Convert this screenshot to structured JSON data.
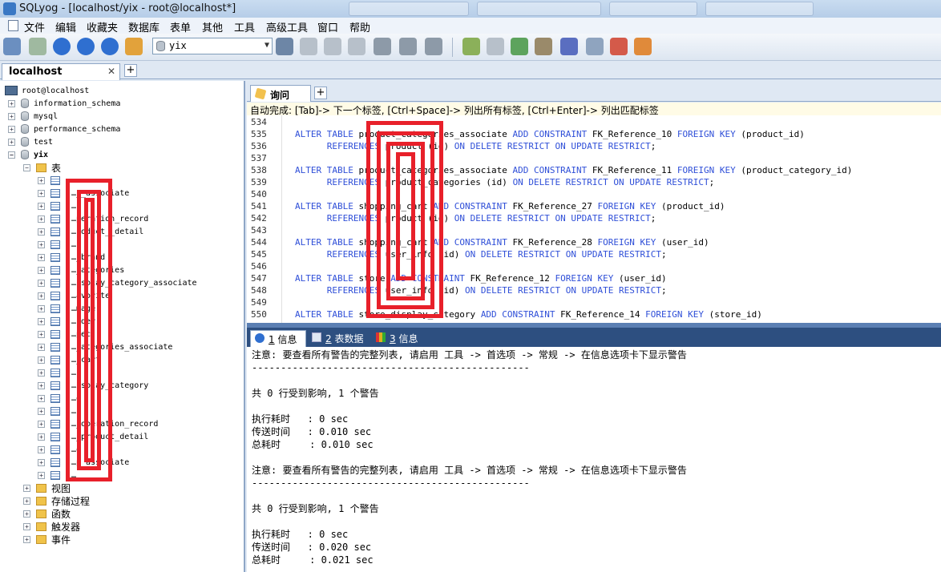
{
  "window": {
    "title": "SQLyog - [localhost/yix - root@localhost*]"
  },
  "menu": [
    "文件",
    "编辑",
    "收藏夹",
    "数据库",
    "表单",
    "其他",
    "工具",
    "高级工具",
    "窗口",
    "帮助"
  ],
  "toolbar": {
    "database_selected": "yix",
    "buttons": [
      "new-connection-icon",
      "refresh-icon",
      "execute-query-icon",
      "execute-all-icon",
      "stop-icon",
      "export-icon",
      "user-manager-icon",
      "create-database-icon",
      "create-table-icon",
      "backup-icon",
      "restore-icon",
      "grid-icon",
      "table-data-icon",
      "result-icon",
      "import-icon",
      "copy-database-icon",
      "schema-sync-icon",
      "data-sync-icon",
      "query-builder-icon",
      "schema-designer-icon",
      "job-agent-icon",
      "notify-icon"
    ]
  },
  "connection_tab": {
    "label": "localhost"
  },
  "object_browser": {
    "root": "root@localhost",
    "databases": [
      "information_schema",
      "mysql",
      "performance_schema",
      "test",
      "yix"
    ],
    "tables_folder": "表",
    "tables": [
      "",
      "…__associate",
      "…",
      "…peration_record",
      "…roduct__detail",
      "…",
      "…_brand",
      "…_ategories",
      "…isplay_category_associate",
      "…avorite",
      "…mage",
      "…rder",
      "…pec",
      "…_ategories_associate",
      "…_cart",
      "…",
      "…isplay_category",
      "…o",
      "…",
      "…_operation_record",
      "…_product_detail",
      "…o",
      "…p_associate",
      "…"
    ],
    "folders": [
      "视图",
      "存储过程",
      "函数",
      "触发器",
      "事件"
    ]
  },
  "query_tab": {
    "label": "询问"
  },
  "autocomplete_hint": "自动完成: [Tab]-> 下一个标签, [Ctrl+Space]-> 列出所有标签, [Ctrl+Enter]-> 列出匹配标签",
  "editor": {
    "lines": [
      {
        "n": "534",
        "text": ""
      },
      {
        "n": "535",
        "text": "ALTER TABLE product_categories_associate ADD CONSTRAINT FK_Reference_10 FOREIGN KEY (product_id)"
      },
      {
        "n": "536",
        "text": "      REFERENCES product (id) ON DELETE RESTRICT ON UPDATE RESTRICT;"
      },
      {
        "n": "537",
        "text": ""
      },
      {
        "n": "538",
        "text": "ALTER TABLE product_categories_associate ADD CONSTRAINT FK_Reference_11 FOREIGN KEY (product_category_id)"
      },
      {
        "n": "539",
        "text": "      REFERENCES product_categories (id) ON DELETE RESTRICT ON UPDATE RESTRICT;"
      },
      {
        "n": "540",
        "text": ""
      },
      {
        "n": "541",
        "text": "ALTER TABLE shopping_cart ADD CONSTRAINT FK_Reference_27 FOREIGN KEY (product_id)"
      },
      {
        "n": "542",
        "text": "      REFERENCES product (id) ON DELETE RESTRICT ON UPDATE RESTRICT;"
      },
      {
        "n": "543",
        "text": ""
      },
      {
        "n": "544",
        "text": "ALTER TABLE shopping_cart ADD CONSTRAINT FK_Reference_28 FOREIGN KEY (user_id)"
      },
      {
        "n": "545",
        "text": "      REFERENCES user_info (id) ON DELETE RESTRICT ON UPDATE RESTRICT;"
      },
      {
        "n": "546",
        "text": ""
      },
      {
        "n": "547",
        "text": "ALTER TABLE store ADD CONSTRAINT FK_Reference_12 FOREIGN KEY (user_id)"
      },
      {
        "n": "548",
        "text": "      REFERENCES user_info (id) ON DELETE RESTRICT ON UPDATE RESTRICT;"
      },
      {
        "n": "549",
        "text": ""
      },
      {
        "n": "550",
        "text": "ALTER TABLE store_display_category ADD CONSTRAINT FK_Reference_14 FOREIGN KEY (store_id)"
      }
    ]
  },
  "result_tabs": [
    {
      "num": "1",
      "label": " 信息"
    },
    {
      "num": "2",
      "label": " 表数据"
    },
    {
      "num": "3",
      "label": " 信息"
    }
  ],
  "results": [
    "注意: 要查看所有警告的完整列表, 请启用 工具 -> 首选项 -> 常规 -> 在信息选项卡下显示警告",
    "------------------------------------------------",
    "",
    "共 0 行受到影响, 1 个警告",
    "",
    "执行耗时   : 0 sec",
    "传送时间   : 0.010 sec",
    "总耗时     : 0.010 sec",
    "",
    "注意: 要查看所有警告的完整列表, 请启用 工具 -> 首选项 -> 常规 -> 在信息选项卡下显示警告",
    "------------------------------------------------",
    "",
    "共 0 行受到影响, 1 个警告",
    "",
    "执行耗时   : 0 sec",
    "传送时间   : 0.020 sec",
    "总耗时     : 0.021 sec"
  ],
  "colors": {
    "keyword": "#2f4fd8",
    "redaction": "#e8202a",
    "results_tab_bar": "#2d4f80"
  }
}
